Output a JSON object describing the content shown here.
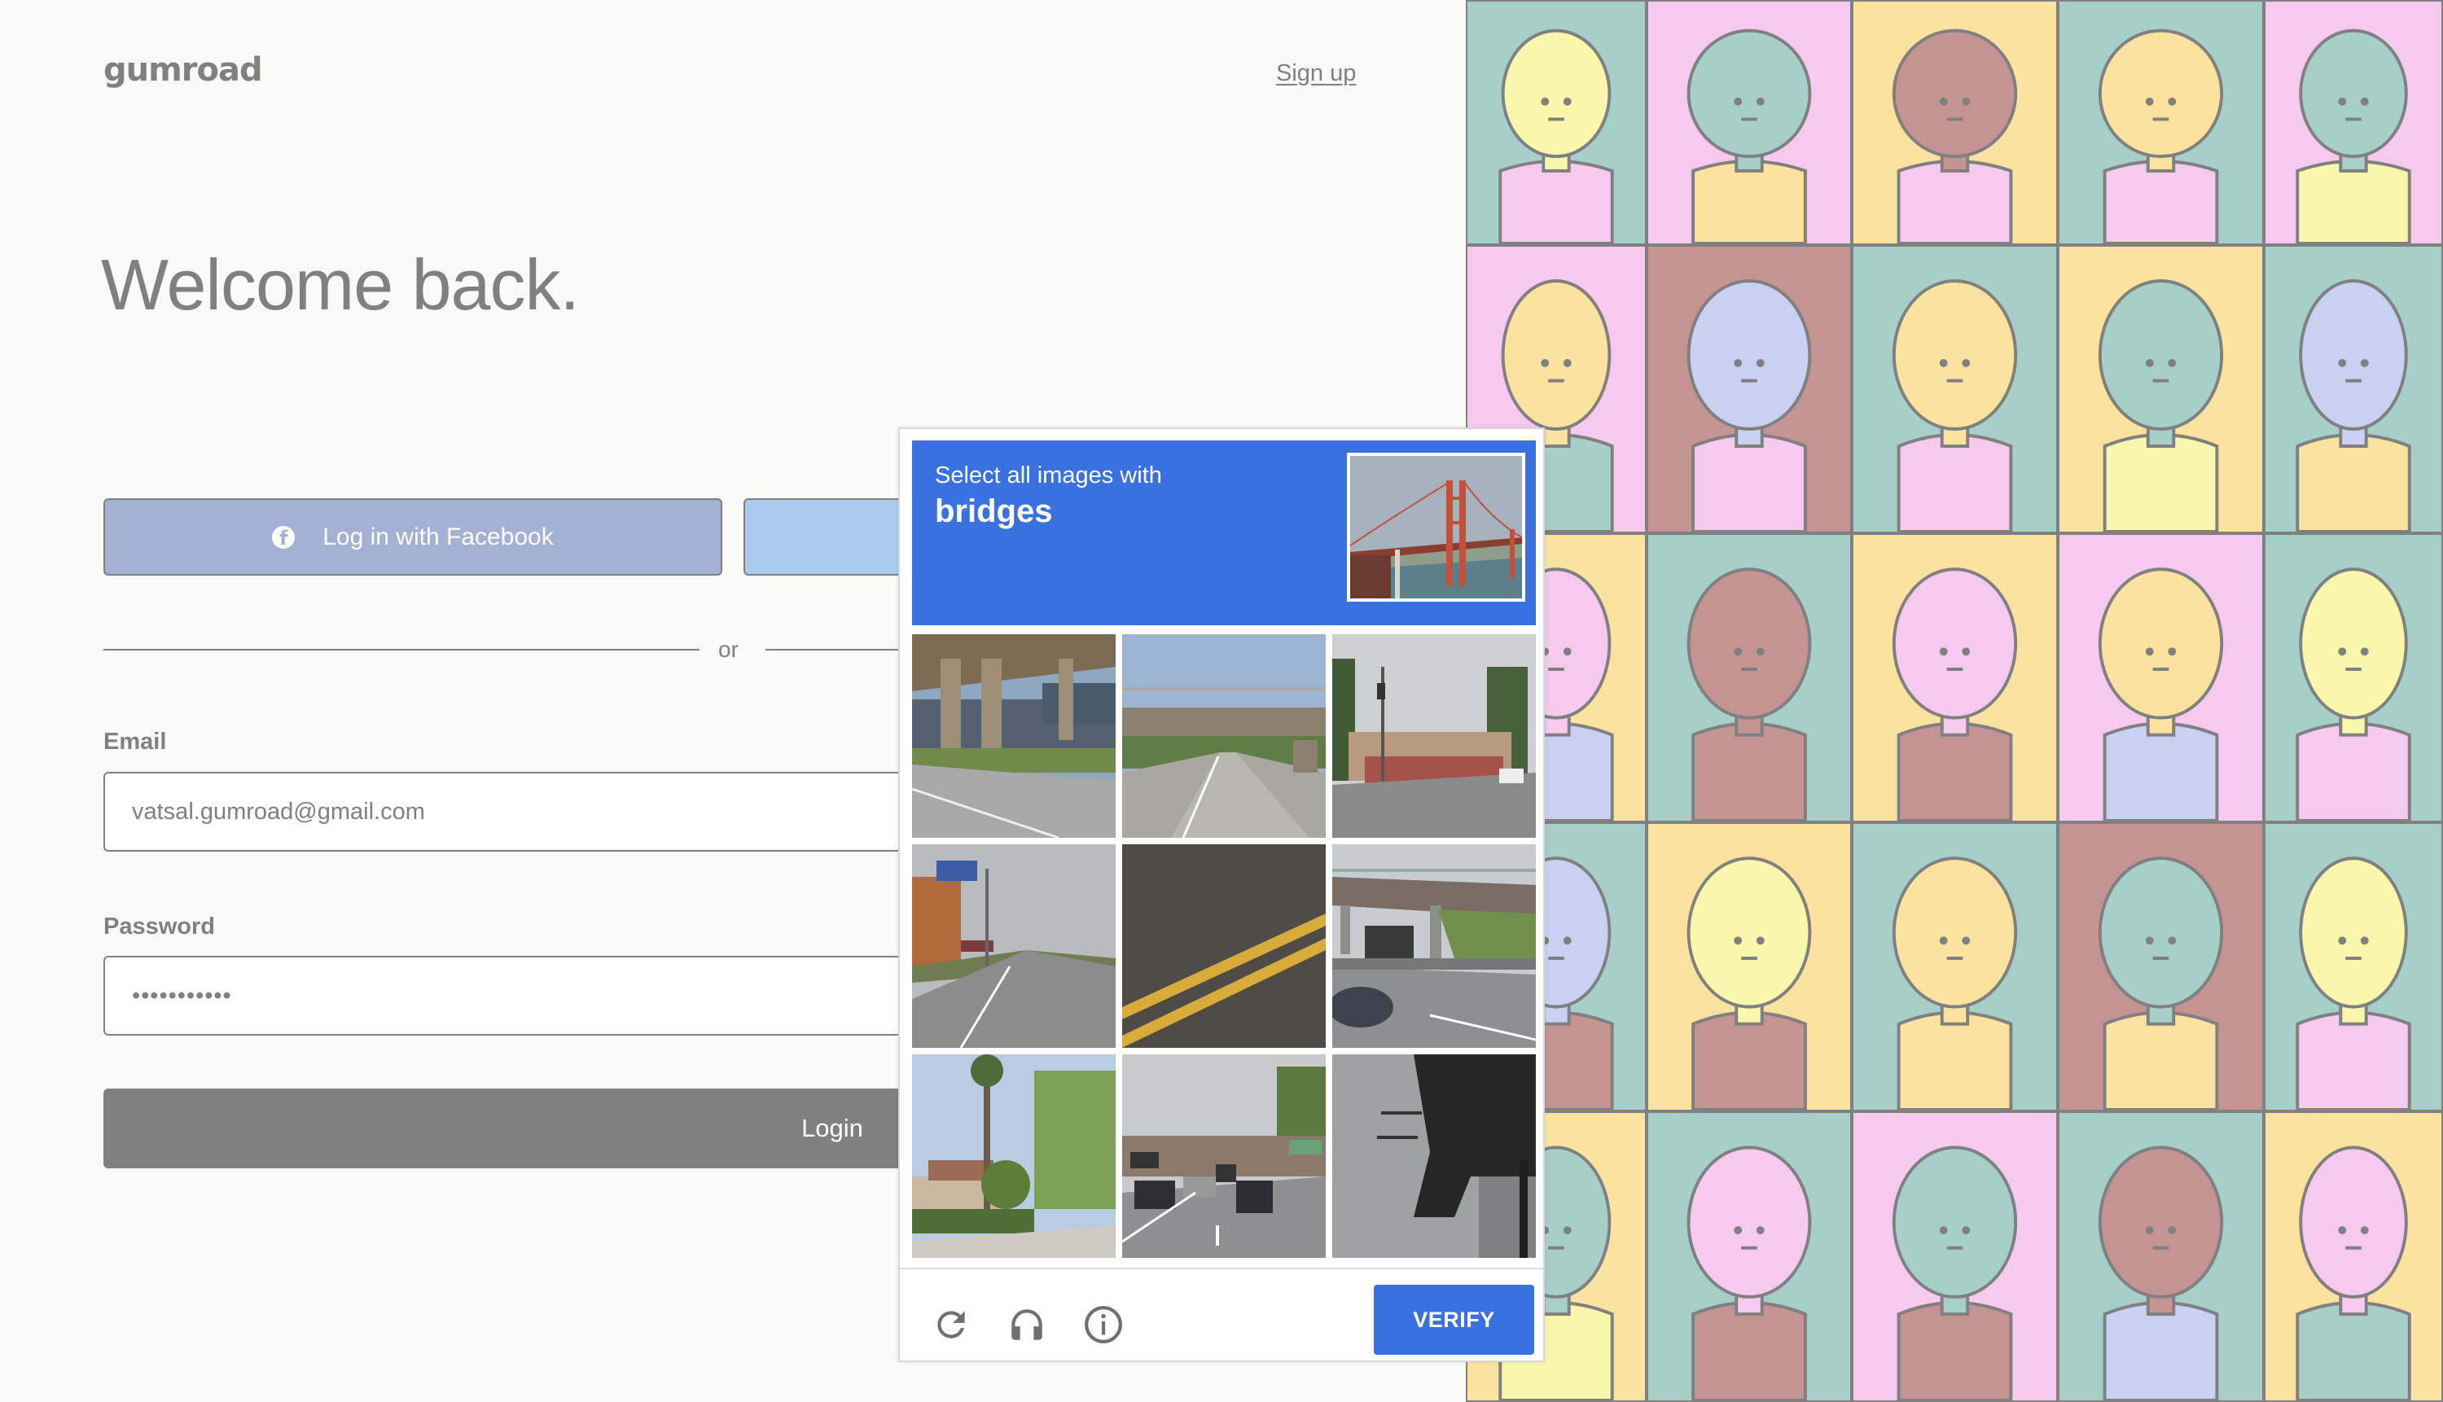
{
  "header": {
    "logo": "gumroad",
    "signup_link": "Sign up"
  },
  "main": {
    "title": "Welcome back.",
    "social": {
      "facebook_label": "Log in with Facebook",
      "facebook_icon": "facebook-icon",
      "second_label": ""
    },
    "divider_text": "or",
    "email": {
      "label": "Email",
      "value": "vatsal.gumroad@gmail.com"
    },
    "password": {
      "label": "Password",
      "value": "•••••••••••"
    },
    "login_label": "Login"
  },
  "captcha": {
    "instruction": "Select all images with",
    "target": "bridges",
    "sample_image": "golden-gate-bridge",
    "tiles": [
      {
        "scene": "highway-overpass-underside"
      },
      {
        "scene": "road-under-overpass"
      },
      {
        "scene": "street-corner-traffic-light"
      },
      {
        "scene": "suburban-road"
      },
      {
        "scene": "asphalt-yellow-lines"
      },
      {
        "scene": "overpass-bridge-highway"
      },
      {
        "scene": "palm-tree-street"
      },
      {
        "scene": "traffic-intersection-cars"
      },
      {
        "scene": "overhead-sign-structure"
      }
    ],
    "icons": [
      "refresh-icon",
      "headphones-icon",
      "info-icon"
    ],
    "verify_label": "VERIFY"
  },
  "colors": {
    "captcha_blue": "#3a71e0",
    "facebook_button": "#a3b1d5",
    "second_social_button": "#abcaf0",
    "login_button": "#808080",
    "art_palette": [
      "#a7cfca",
      "#f6c9ef",
      "#fbe39f",
      "#c49392",
      "#f8f7ac",
      "#c9d1f2"
    ]
  }
}
